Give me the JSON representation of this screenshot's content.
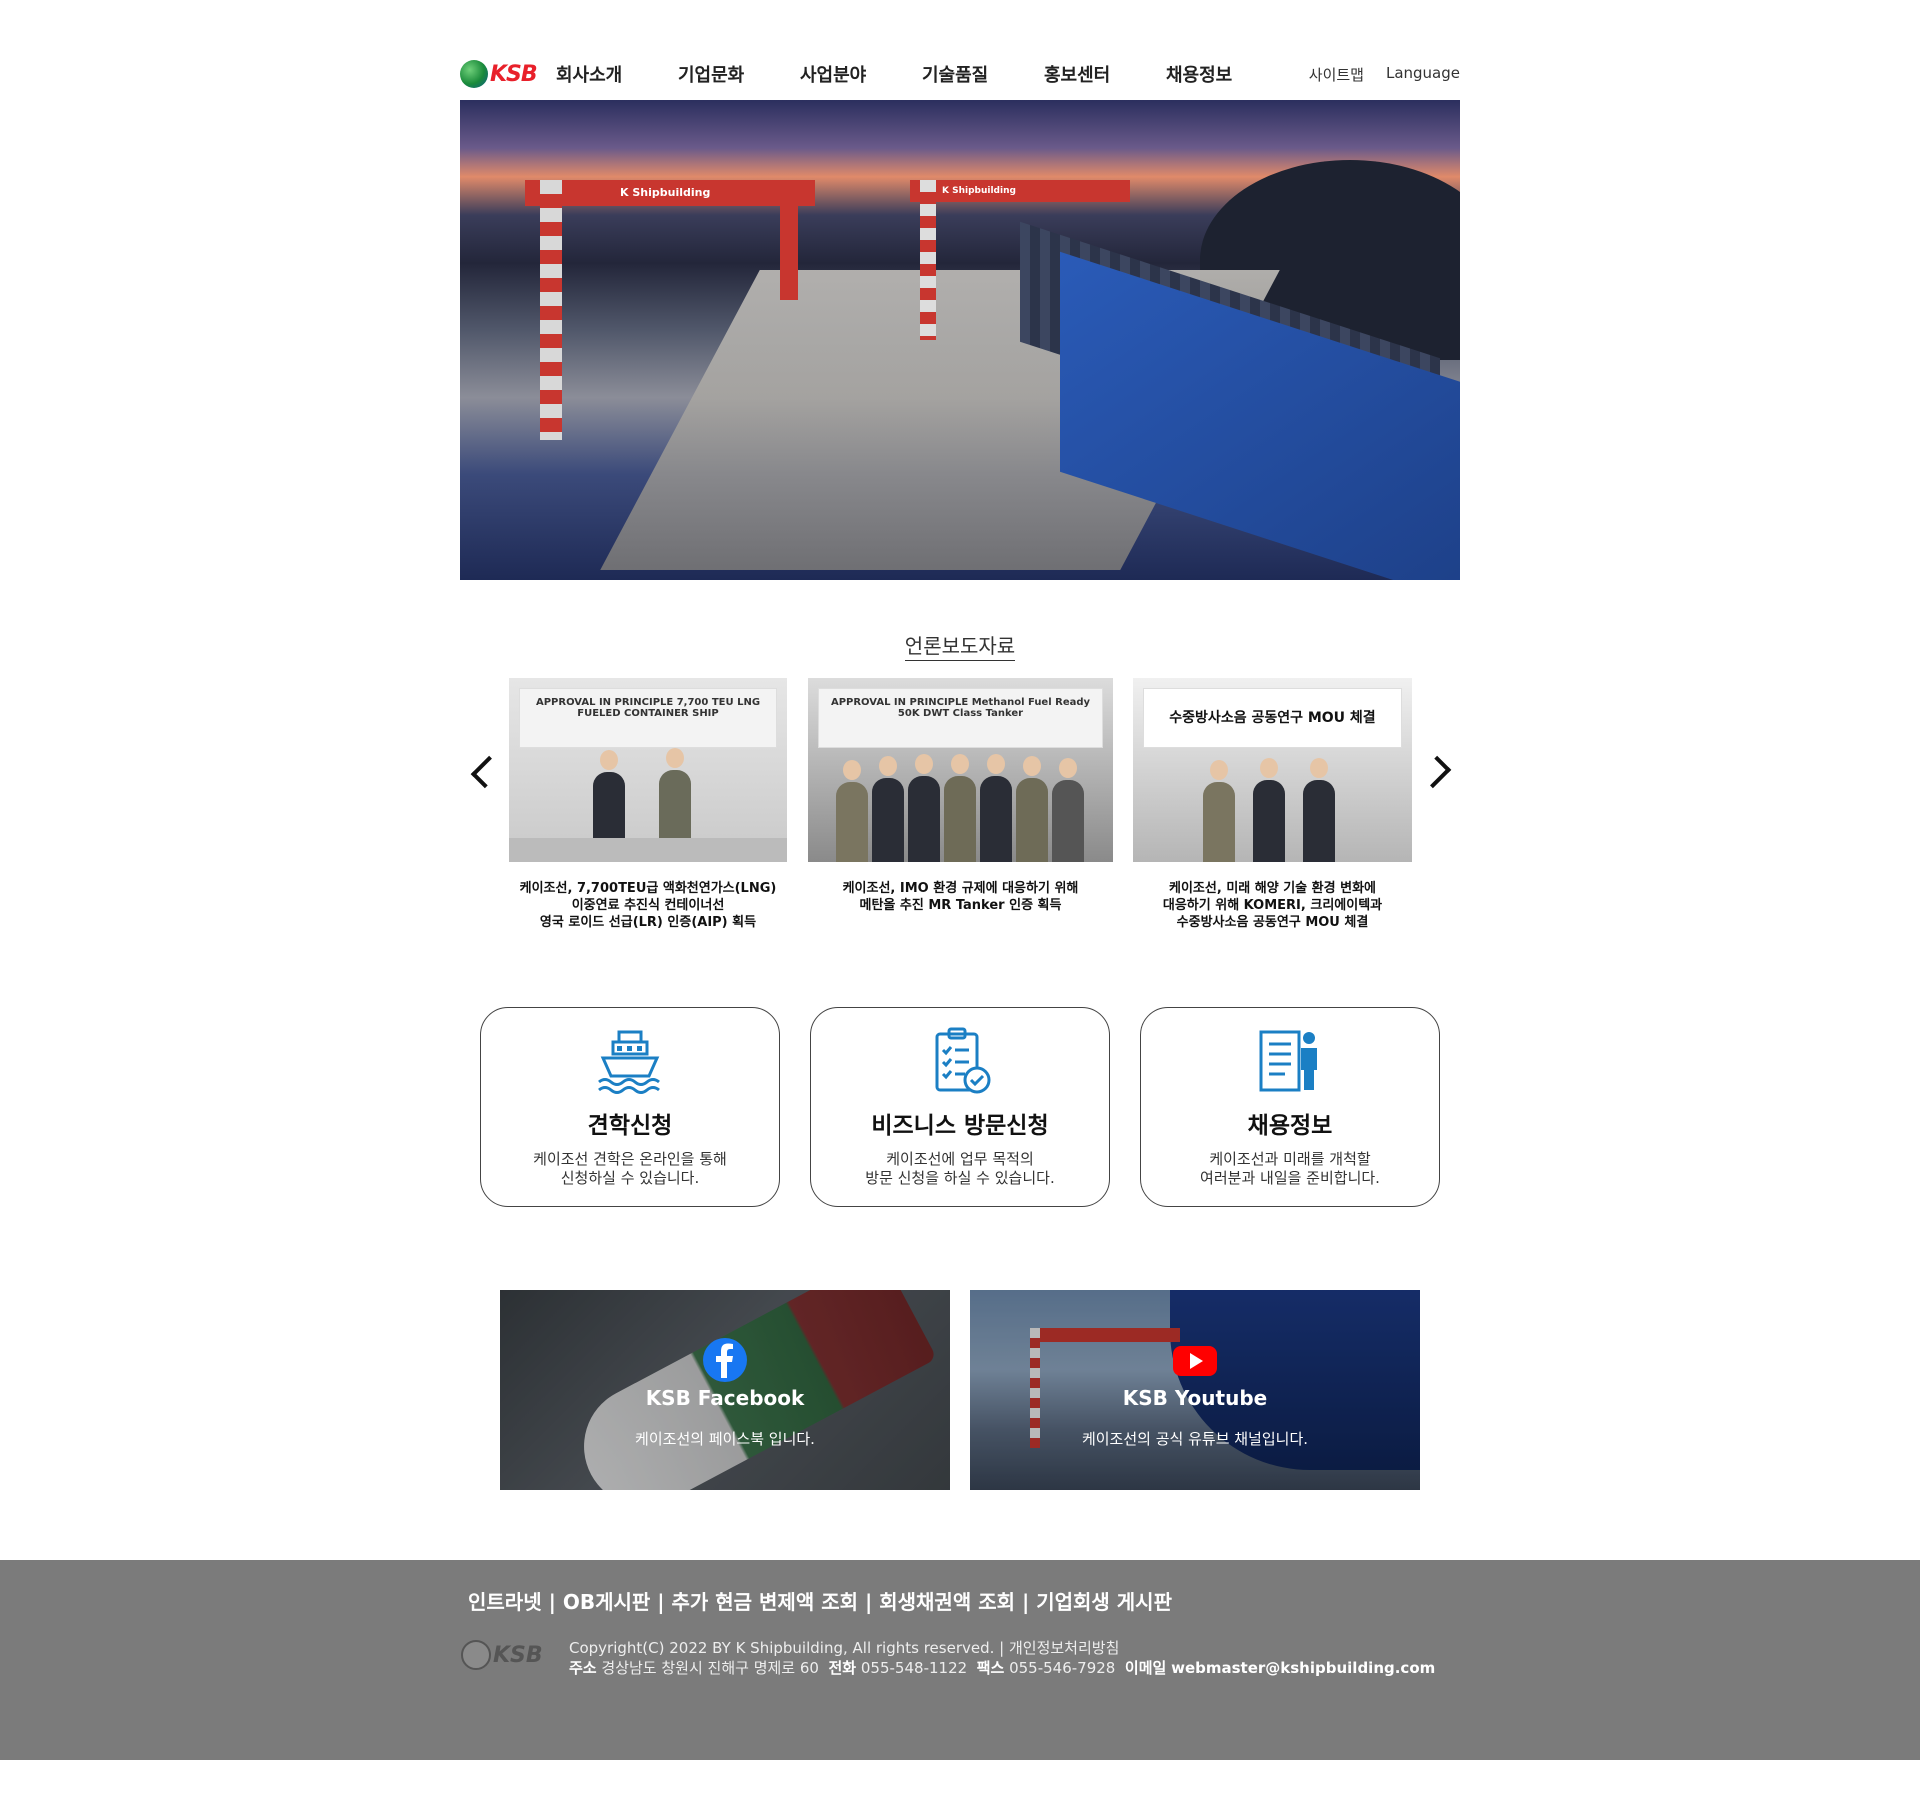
{
  "header": {
    "logo_text": "KSB",
    "nav": [
      "회사소개",
      "기업문화",
      "사업분야",
      "기술품질",
      "홍보센터",
      "채용정보"
    ],
    "sitemap": "사이트맵",
    "language": "Language"
  },
  "hero": {
    "crane_label_1": "K Shipbuilding",
    "crane_label_2": "K Shipbuilding"
  },
  "press": {
    "title": "언론보도자료",
    "items": [
      {
        "board_text": "APPROVAL IN PRINCIPLE 7,700 TEU LNG FUELED CONTAINER SHIP",
        "caption_lines": [
          "케이조선, 7,700TEU급 액화천연가스(LNG)",
          "이중연료 추진식 컨테이너선",
          "영국 로이드 선급(LR) 인증(AIP) 획득"
        ]
      },
      {
        "board_text": "APPROVAL IN PRINCIPLE Methanol Fuel Ready 50K DWT Class Tanker",
        "caption_lines": [
          "케이조선, IMO 환경 규제에 대응하기 위해",
          "메탄올 추진 MR Tanker 인증 획득"
        ]
      },
      {
        "board_text": "수중방사소음 공동연구 MOU 체결",
        "caption_lines": [
          "케이조선, 미래 해양 기술 환경 변화에",
          "대응하기 위해 KOMERI, 크리에이텍과",
          "수중방사소음 공동연구 MOU 체결"
        ]
      }
    ]
  },
  "services": [
    {
      "title": "견학신청",
      "desc_lines": [
        "케이조선 견학은 온라인을 통해",
        "신청하실 수 있습니다."
      ],
      "icon": "ship-icon"
    },
    {
      "title": "비즈니스 방문신청",
      "desc_lines": [
        "케이조선에 업무 목적의",
        "방문 신청을 하실 수 있습니다."
      ],
      "icon": "clipboard-check-icon"
    },
    {
      "title": "채용정보",
      "desc_lines": [
        "케이조선과 미래를 개척할",
        "여러분과 내일을 준비합니다."
      ],
      "icon": "recruit-document-person-icon"
    }
  ],
  "sns": [
    {
      "name": "KSB Facebook",
      "desc": "케이조선의 페이스북 입니다.",
      "icon": "facebook-icon"
    },
    {
      "name": "KSB Youtube",
      "desc": "케이조선의 공식 유튜브 채널입니다.",
      "icon": "youtube-icon"
    }
  ],
  "footer": {
    "links": "인트라넷 | OB게시판 | 추가 현금 변제액 조회 | 회생채권액 조회 | 기업회생 게시판",
    "logo_text": "KSB",
    "copyright": "Copyright(C) 2022 BY K Shipbuilding, All rights reserved. | 개인정보처리방침",
    "address_label": "주소",
    "address": "경상남도 창원시 진해구 명제로 60",
    "phone_label": "전화",
    "phone": "055-548-1122",
    "fax_label": "팩스",
    "fax": "055-546-7928",
    "email_label": "이메일",
    "email": "webmaster@kshipbuilding.com"
  },
  "colors": {
    "brand_red": "#e8202a",
    "icon_blue": "#1b7fc4",
    "footer_gray": "#7b7b7b",
    "facebook_blue": "#1877f2",
    "youtube_red": "#ff0000"
  }
}
